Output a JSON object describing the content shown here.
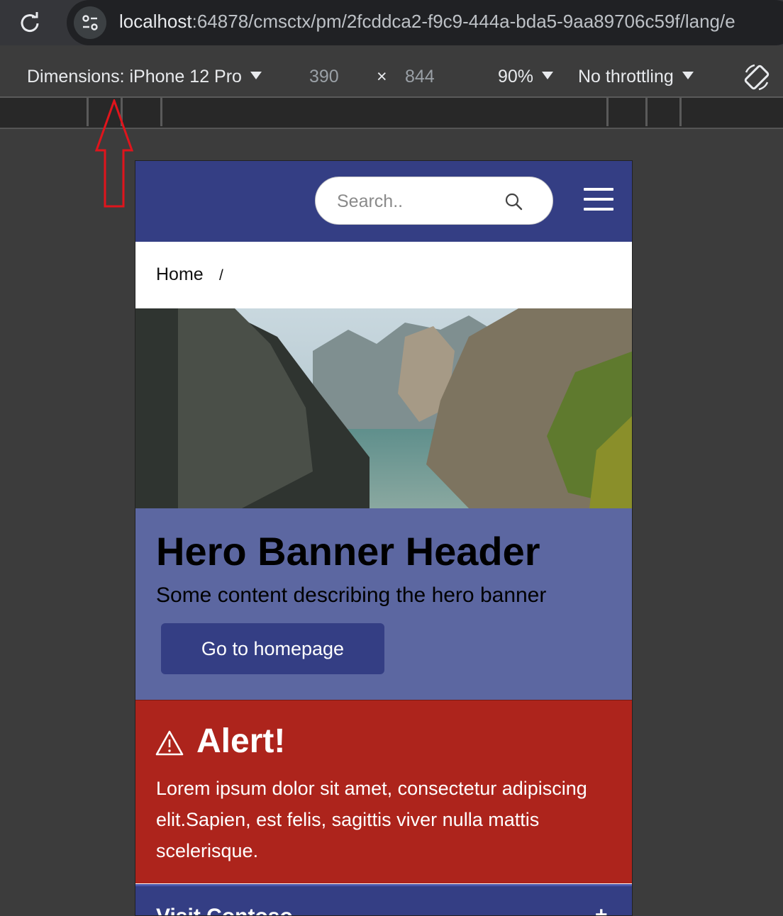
{
  "browser": {
    "url_host": "localhost",
    "url_rest": ":64878/cmsctx/pm/2fcddca2-f9c9-444a-bda5-9aa89706c59f/lang/e"
  },
  "devtools": {
    "dimensions_label": "Dimensions: iPhone 12 Pro",
    "width": "390",
    "times": "×",
    "height": "844",
    "zoom": "90%",
    "throttling": "No throttling"
  },
  "site": {
    "search_placeholder": "Search..",
    "breadcrumb": {
      "home": "Home",
      "separator": "/"
    },
    "hero": {
      "title": "Hero Banner Header",
      "text": "Some content describing the hero banner",
      "button": "Go to homepage"
    },
    "alert": {
      "title": "Alert!",
      "body": "Lorem ipsum dolor sit amet, consectetur adipiscing elit.Sapien, est felis, sagittis viver nulla mattis scelerisque."
    },
    "visit": {
      "title": "Visit Contoso",
      "toggle": "+"
    }
  },
  "colors": {
    "header": "#343e84",
    "hero_panel": "#5c67a1",
    "alert": "#ad241c",
    "annotation_arrow": "#e0141c"
  }
}
